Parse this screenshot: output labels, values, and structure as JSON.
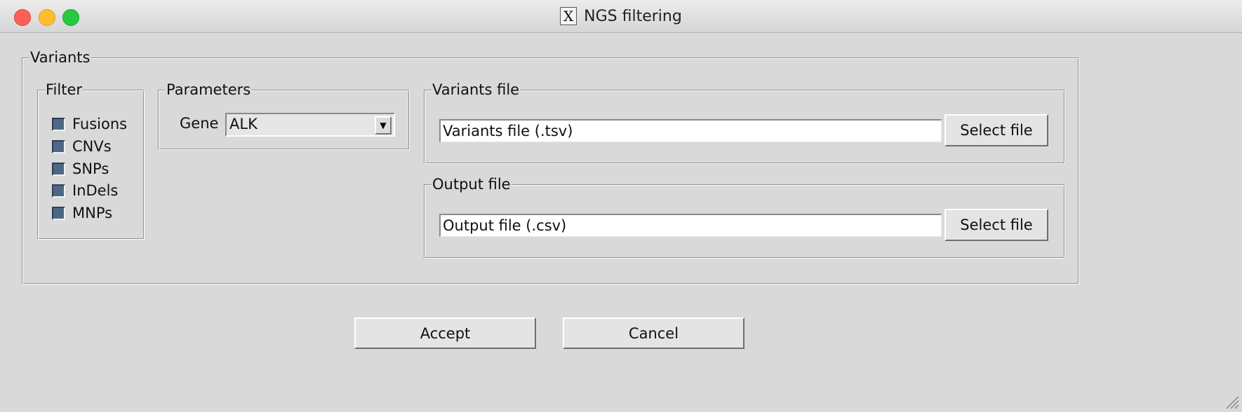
{
  "window": {
    "title": "NGS filtering",
    "title_icon": "x11-icon",
    "controls": [
      "close",
      "minimize",
      "maximize"
    ]
  },
  "variants_group": {
    "legend": "Variants",
    "filter": {
      "legend": "Filter",
      "options": [
        {
          "label": "Fusions"
        },
        {
          "label": "CNVs"
        },
        {
          "label": "SNPs"
        },
        {
          "label": "InDels"
        },
        {
          "label": "MNPs"
        }
      ]
    },
    "parameters": {
      "legend": "Parameters",
      "gene_label": "Gene",
      "gene_value": "ALK"
    },
    "variants_file": {
      "legend": "Variants file",
      "value": "Variants file (.tsv)",
      "button": "Select file"
    },
    "output_file": {
      "legend": "Output file",
      "value": "Output file (.csv)",
      "button": "Select file"
    }
  },
  "actions": {
    "accept": "Accept",
    "cancel": "Cancel"
  },
  "colors": {
    "window_bg": "#d9d9d9",
    "checkbox_fill": "#4d6785",
    "close": "#fe5f57",
    "minimize": "#febc2e",
    "maximize": "#28c840"
  }
}
